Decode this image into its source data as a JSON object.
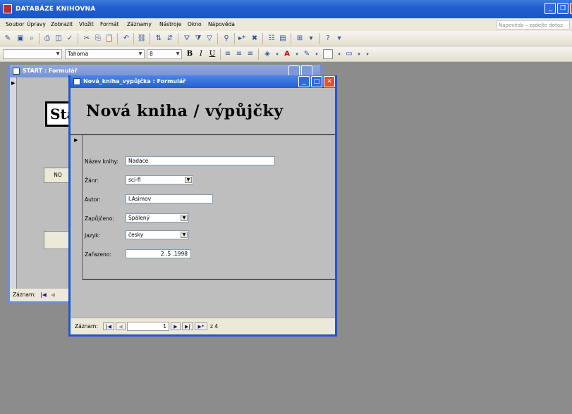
{
  "app": {
    "title": "DATABÁZE KNIHOVNA",
    "caption_min": "_",
    "caption_max": "❐",
    "caption_close": "✕"
  },
  "menu": {
    "items": [
      "Soubor",
      "Úpravy",
      "Zobrazit",
      "Vložit",
      "Formát",
      "Záznamy",
      "Nástroje",
      "Okno",
      "Nápověda"
    ],
    "help_placeholder": "Nápověda – zadejte dotaz"
  },
  "format_toolbar": {
    "font_name": "Tahoma",
    "font_size": "8",
    "bold": "B",
    "italic": "I",
    "underline": "U"
  },
  "start_form": {
    "title": "START : Formulář",
    "header_text": "Sta",
    "button1": "NO",
    "record_label": "Záznam:"
  },
  "nova_kniha_form": {
    "title": "Nová_kniha_vypůjčka : Formulář",
    "heading": "Nová kniha / výpůjčky",
    "fields": {
      "nazev_label": "Název knihy:",
      "nazev_value": "Nadace",
      "zanr_label": "Žánr:",
      "zanr_value": "sci-fi",
      "autor_label": "Autor:",
      "autor_value": "I.Asimov",
      "zapujceno_label": "Zapůjčeno:",
      "zapujceno_value": "Spálený",
      "jazyk_label": "Jazyk:",
      "jazyk_value": "česky",
      "zarazeno_label": "Zařazeno:",
      "zarazeno_value": "2 .5 .1998"
    },
    "record_nav": {
      "label": "Záznam:",
      "current": "1",
      "total_text": "z 4"
    }
  },
  "colors": {
    "titlebar": "#235fd1",
    "mdi_background": "#8c8c8c",
    "form_section": "#bebebe"
  }
}
